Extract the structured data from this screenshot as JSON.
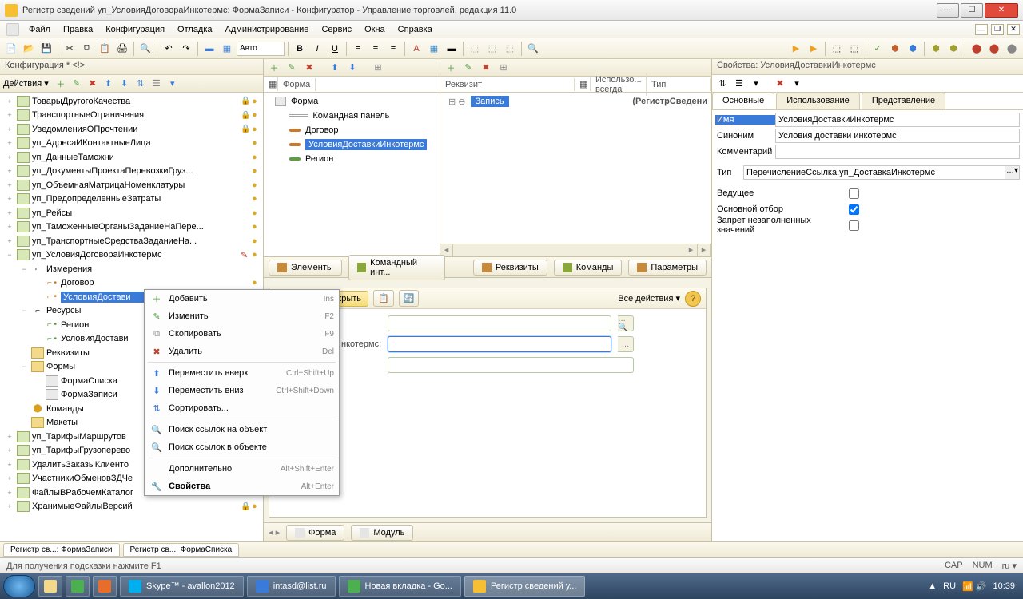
{
  "window": {
    "title": "Регистр сведений уп_УсловияДоговораИнкотермс: ФормаЗаписи - Конфигуратор - Управление торговлей, редакция 11.0"
  },
  "menu": {
    "file": "Файл",
    "edit": "Правка",
    "config": "Конфигурация",
    "debug": "Отладка",
    "admin": "Администрирование",
    "service": "Сервис",
    "windows": "Окна",
    "help": "Справка"
  },
  "toolbar_auto": "Авто",
  "config_panel": {
    "title": "Конфигурация * <!>",
    "actions": "Действия ▾",
    "tree": [
      {
        "lvl": 1,
        "exp": "+",
        "ico": "reg",
        "label": "ТоварыДругогоКачества",
        "lock": true,
        "mark": true
      },
      {
        "lvl": 1,
        "exp": "+",
        "ico": "reg",
        "label": "ТранспортныеОграничения",
        "lock": true,
        "mark": true
      },
      {
        "lvl": 1,
        "exp": "+",
        "ico": "reg",
        "label": "УведомленияОПрочтении",
        "lock": true,
        "mark": true
      },
      {
        "lvl": 1,
        "exp": "+",
        "ico": "reg",
        "label": "уп_АдресаИКонтактныеЛица",
        "lock": false,
        "mark": true
      },
      {
        "lvl": 1,
        "exp": "+",
        "ico": "reg",
        "label": "уп_ДанныеТаможни",
        "lock": false,
        "mark": true
      },
      {
        "lvl": 1,
        "exp": "+",
        "ico": "reg",
        "label": "уп_ДокументыПроектаПеревозкиГруз...",
        "lock": false,
        "mark": true
      },
      {
        "lvl": 1,
        "exp": "+",
        "ico": "reg",
        "label": "уп_ОбъемнаяМатрицаНоменклатуры",
        "lock": false,
        "mark": true
      },
      {
        "lvl": 1,
        "exp": "+",
        "ico": "reg",
        "label": "уп_ПредопределенныеЗатраты",
        "lock": false,
        "mark": true
      },
      {
        "lvl": 1,
        "exp": "+",
        "ico": "reg",
        "label": "уп_Рейсы",
        "lock": false,
        "mark": true
      },
      {
        "lvl": 1,
        "exp": "+",
        "ico": "reg",
        "label": "уп_ТаможенныеОрганыЗаданиеНаПере...",
        "lock": false,
        "mark": true
      },
      {
        "lvl": 1,
        "exp": "+",
        "ico": "reg",
        "label": "уп_ТранспортныеСредстваЗаданиеНа...",
        "lock": false,
        "mark": true
      },
      {
        "lvl": 1,
        "exp": "−",
        "ico": "reg",
        "label": "уп_УсловияДоговораИнкотермс",
        "lock": false,
        "mark": true,
        "edited": true
      },
      {
        "lvl": 2,
        "exp": "−",
        "ico": "dim",
        "label": "Измерения"
      },
      {
        "lvl": 3,
        "exp": "",
        "ico": "dimf",
        "label": "Договор",
        "mark": true
      },
      {
        "lvl": 3,
        "exp": "",
        "ico": "dimf",
        "label": "УсловияДостави",
        "selected": true,
        "mark": true
      },
      {
        "lvl": 2,
        "exp": "−",
        "ico": "res",
        "label": "Ресурсы"
      },
      {
        "lvl": 3,
        "exp": "",
        "ico": "resf",
        "label": "Регион",
        "mark": true
      },
      {
        "lvl": 3,
        "exp": "",
        "ico": "resf",
        "label": "УсловияДостави",
        "mark": true
      },
      {
        "lvl": 2,
        "exp": "",
        "ico": "folder",
        "label": "Реквизиты"
      },
      {
        "lvl": 2,
        "exp": "−",
        "ico": "folder",
        "label": "Формы"
      },
      {
        "lvl": 3,
        "exp": "",
        "ico": "form",
        "label": "ФормаСписка",
        "mark": true
      },
      {
        "lvl": 3,
        "exp": "",
        "ico": "form",
        "label": "ФормаЗаписи",
        "mark": true
      },
      {
        "lvl": 2,
        "exp": "",
        "ico": "cmd",
        "label": "Команды"
      },
      {
        "lvl": 2,
        "exp": "",
        "ico": "folder",
        "label": "Макеты"
      },
      {
        "lvl": 1,
        "exp": "+",
        "ico": "reg",
        "label": "уп_ТарифыМаршрутов",
        "lock": false,
        "mark": true
      },
      {
        "lvl": 1,
        "exp": "+",
        "ico": "reg",
        "label": "уп_ТарифыГрузоперево",
        "lock": false,
        "mark": true
      },
      {
        "lvl": 1,
        "exp": "+",
        "ico": "reg",
        "label": "УдалитьЗаказыКлиенто",
        "lock": true,
        "mark": true
      },
      {
        "lvl": 1,
        "exp": "+",
        "ico": "reg",
        "label": "УчастникиОбменовЗДЧе",
        "lock": true,
        "mark": true
      },
      {
        "lvl": 1,
        "exp": "+",
        "ico": "reg",
        "label": "ФайлыВРабочемКаталог",
        "lock": true,
        "mark": true
      },
      {
        "lvl": 1,
        "exp": "+",
        "ico": "reg",
        "label": "ХранимыеФайлыВерсий",
        "lock": true,
        "mark": true
      }
    ]
  },
  "form_editor": {
    "left_header": "Форма",
    "items": [
      {
        "label": "Форма",
        "ico": "form",
        "lvl": 0
      },
      {
        "label": "Командная панель",
        "ico": "bar",
        "lvl": 1
      },
      {
        "label": "Договор",
        "ico": "dash",
        "color": "#c77a2e",
        "lvl": 1
      },
      {
        "label": "УсловияДоставкиИнкотермс",
        "ico": "dash",
        "color": "#c77a2e",
        "lvl": 1,
        "sel": true
      },
      {
        "label": "Регион",
        "ico": "dash",
        "color": "#5aa03a",
        "lvl": 1
      }
    ],
    "right_headers": {
      "rek": "Реквизит",
      "use": "Использо... всегда",
      "type": "Тип"
    },
    "right_row": {
      "label": "Запись",
      "type": "(РегистрСведени"
    },
    "tabs": {
      "elements": "Элементы",
      "cmdint": "Командный инт...",
      "rekv": "Реквизиты",
      "cmds": "Команды",
      "params": "Параметры"
    }
  },
  "preview": {
    "all_actions": "Все действия ▾",
    "field2": "нкотермс:",
    "save_close": "Записать и закрыть"
  },
  "bottom_tabs": {
    "form": "Форма",
    "module": "Модуль"
  },
  "props": {
    "title": "Свойства: УсловияДоставкиИнкотермс",
    "tabs": {
      "main": "Основные",
      "use": "Использование",
      "view": "Представление"
    },
    "name_label": "Имя",
    "name_val": "УсловияДоставкиИнкотермс",
    "syn_label": "Синоним",
    "syn_val": "Условия доставки инкотермс",
    "comment_label": "Комментарий",
    "comment_val": "",
    "type_label": "Тип",
    "type_val": "ПеречислениеСсылка.уп_ДоставкаИнкотермс",
    "leading": "Ведущее",
    "main_filter": "Основной отбор",
    "no_empty": "Запрет незаполненных значений"
  },
  "doc_tabs": {
    "t1": "Регистр св...: ФормаЗаписи",
    "t2": "Регистр св...: ФормаСписка"
  },
  "status": {
    "hint": "Для получения подсказки нажмите F1",
    "cap": "CAP",
    "num": "NUM",
    "lang": "ru ▾"
  },
  "taskbar": {
    "items": [
      {
        "label": "Skype™ - avallon2012",
        "ico": "#00aff0"
      },
      {
        "label": "intasd@list.ru",
        "ico": "#3a7ad9"
      },
      {
        "label": "Новая вкладка - Go...",
        "ico": "#4caf50"
      },
      {
        "label": "Регистр сведений у...",
        "ico": "#f7c033",
        "active": true
      }
    ],
    "tray": {
      "lang": "RU",
      "time": "10:39"
    }
  },
  "context_menu": [
    {
      "ico": "add",
      "label": "Добавить",
      "sc": "Ins"
    },
    {
      "ico": "edit",
      "label": "Изменить",
      "sc": "F2"
    },
    {
      "ico": "copy",
      "label": "Скопировать",
      "sc": "F9"
    },
    {
      "ico": "del",
      "label": "Удалить",
      "sc": "Del"
    },
    {
      "sep": true
    },
    {
      "ico": "up",
      "label": "Переместить вверх",
      "sc": "Ctrl+Shift+Up"
    },
    {
      "ico": "down",
      "label": "Переместить вниз",
      "sc": "Ctrl+Shift+Down"
    },
    {
      "ico": "sort",
      "label": "Сортировать...",
      "sc": ""
    },
    {
      "sep": true
    },
    {
      "ico": "search",
      "label": "Поиск ссылок на объект",
      "sc": ""
    },
    {
      "ico": "search",
      "label": "Поиск ссылок в объекте",
      "sc": ""
    },
    {
      "sep": true
    },
    {
      "ico": "",
      "label": "Дополнительно",
      "sc": "Alt+Shift+Enter"
    },
    {
      "ico": "wrench",
      "label": "Свойства",
      "sc": "Alt+Enter",
      "bold": true
    }
  ]
}
